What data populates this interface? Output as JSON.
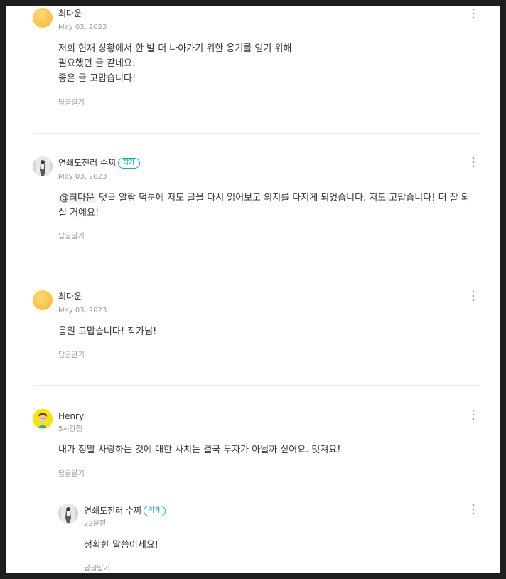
{
  "comments": [
    {
      "author": "최다운",
      "date": "May 03, 2023",
      "lines": [
        "저희 현재 상황에서 한 발 더 나아가기 위한 용기를 얻기 위해",
        "필요했던 글 같네요.",
        "좋은 글 고맙습니다!"
      ],
      "reply_label": "답글달기"
    },
    {
      "author": "연쇄도전러 수찌",
      "badge": "작가",
      "date": "May 03, 2023",
      "mention": "@최다운",
      "lines": [
        "댓글 알람 덕분에 저도 글을 다시 읽어보고 의지를 다지게 되었습니다. 저도 고맙습니다! 더 잘 되",
        "실 거예요!"
      ],
      "reply_label": "답글달기"
    },
    {
      "author": "최다운",
      "date": "May 03, 2023",
      "lines": [
        "응원 고맙습니다! 작가님!"
      ],
      "reply_label": "답글달기"
    },
    {
      "author": "Henry",
      "date": "5시간전",
      "lines": [
        "내가 정말 사랑하는 것에 대한 사치는 결국 투자가 아닐까 싶어요. 멋져요!"
      ],
      "reply_label": "답글달기"
    },
    {
      "author": "연쇄도전러 수찌",
      "badge": "작가",
      "date": "22분전",
      "lines": [
        "정확한 말씀이세요!"
      ],
      "reply_label": "답글달기"
    }
  ],
  "icons": {
    "more": "more-vertical-icon"
  },
  "colors": {
    "badge": "#00b8c8",
    "text": "#333333",
    "muted": "#999999"
  }
}
